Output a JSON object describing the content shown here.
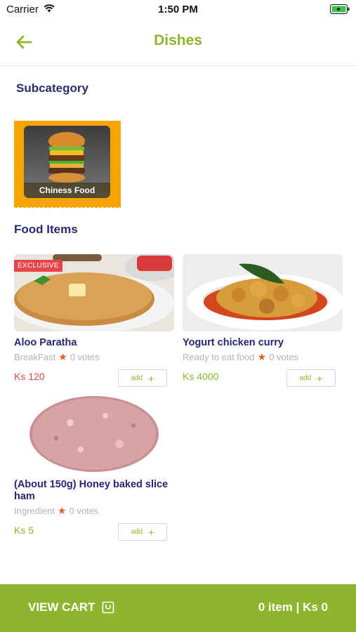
{
  "status": {
    "carrier": "Carrier",
    "time": "1:50 PM"
  },
  "nav": {
    "title": "Dishes"
  },
  "subcategory_section": {
    "title": "Subcategory"
  },
  "subcategories": [
    {
      "label": "Chiness Food"
    }
  ],
  "food_section": {
    "title": "Food Items"
  },
  "food_items": [
    {
      "badge": "EXCLUSIVE",
      "name": "Aloo Paratha",
      "category": "BreakFast",
      "votes": "0 votes",
      "price": "Ks 120",
      "price_color": "#e8454a",
      "add_label": "add"
    },
    {
      "name": "Yogurt chicken curry",
      "category": "Ready to eat food",
      "votes": "0 votes",
      "price": "Ks 4000",
      "price_color": "#8db52e",
      "add_label": "add"
    },
    {
      "name": "(About 150g) Honey baked slice ham",
      "category": "Ingredient",
      "votes": "0 votes",
      "price": "Ks 5",
      "price_color": "#8db52e",
      "add_label": "add"
    }
  ],
  "cart": {
    "view_label": "VIEW CART",
    "summary": "0 item | Ks 0"
  },
  "colors": {
    "accent": "#8db52e",
    "title": "#262672",
    "badge": "#e8454a",
    "star": "#ef5a24",
    "subcat_bg": "#f6a400"
  }
}
